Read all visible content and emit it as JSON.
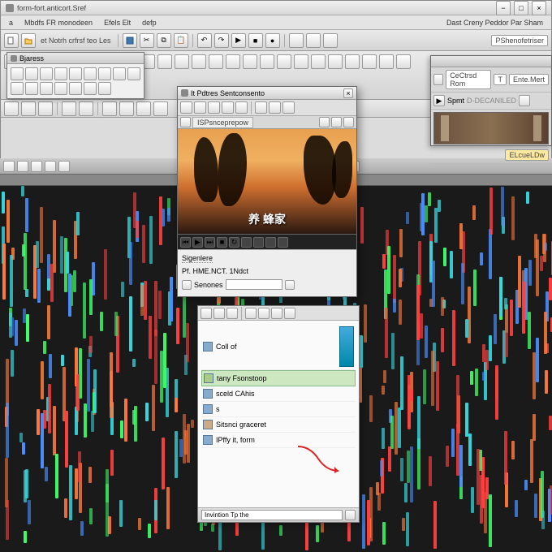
{
  "main": {
    "title": "form-fort.anticort.Sref",
    "menu": [
      "a",
      "Mbdfs FR monodeen",
      "Efels Elt",
      "defp",
      "Dast Creny Peddor Par Sham"
    ],
    "toolbar2_label": "et Notrh crfrsf teo Les",
    "toolbar2_btn": "PShenofetriser"
  },
  "browser_panel": {
    "title": "Bjaress"
  },
  "right_panel": {
    "row1": [
      "CeCtrsd Rom",
      "T",
      "Ente.Mert"
    ],
    "row2a": "Spmt",
    "row2b": "D-DECANILED",
    "row3": "ELcueLDw"
  },
  "preview_win": {
    "title": "It Pdtres Sentconsento",
    "tab": "ISPsnceprepow",
    "overlay": "养 蜂家",
    "section": "Sigenlere",
    "field1": "Pf. HME.NCT. 1Ndct",
    "field2_label": "Senones"
  },
  "layers": {
    "item1_a": "Coll of",
    "item2": "tany Fsonstoop",
    "item3": "sceld CAhis",
    "item4": "s",
    "item5": "Sitsnci graceret",
    "item6": "IPffy it, form",
    "footer": "Invintion Tp the"
  },
  "colors": {
    "clip_green": "#3eff6a",
    "clip_cyan": "#36d8e0",
    "clip_orange": "#ff7a3a",
    "clip_red": "#ff4040",
    "clip_blue": "#4a90ff"
  }
}
